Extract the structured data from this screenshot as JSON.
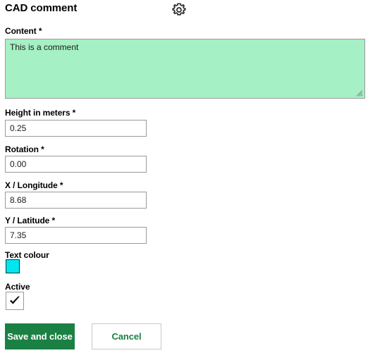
{
  "panel": {
    "title": "CAD comment",
    "settings_icon": "gear-icon"
  },
  "fields": {
    "content": {
      "label": "Content *",
      "value": "This is a comment",
      "placeholder": "",
      "background_color": "#A5F0C4"
    },
    "height": {
      "label": "Height in meters *",
      "value": "0.25",
      "placeholder": ""
    },
    "rotation": {
      "label": "Rotation *",
      "value": "0.00",
      "placeholder": ""
    },
    "longitude": {
      "label": "X / Longitude *",
      "value": "8.68",
      "placeholder": ""
    },
    "latitude": {
      "label": "Y / Latitude *",
      "value": "7.35",
      "placeholder": ""
    },
    "text_colour": {
      "label": "Text colour",
      "value": "#00E5F0"
    },
    "active": {
      "label": "Active",
      "checked": true
    }
  },
  "buttons": {
    "save": "Save and close",
    "cancel": "Cancel"
  },
  "colors": {
    "primary_green": "#1B8044",
    "content_green": "#A5F0C4",
    "swatch_cyan": "#00E5F0",
    "border_grey": "#9A9A9A"
  }
}
